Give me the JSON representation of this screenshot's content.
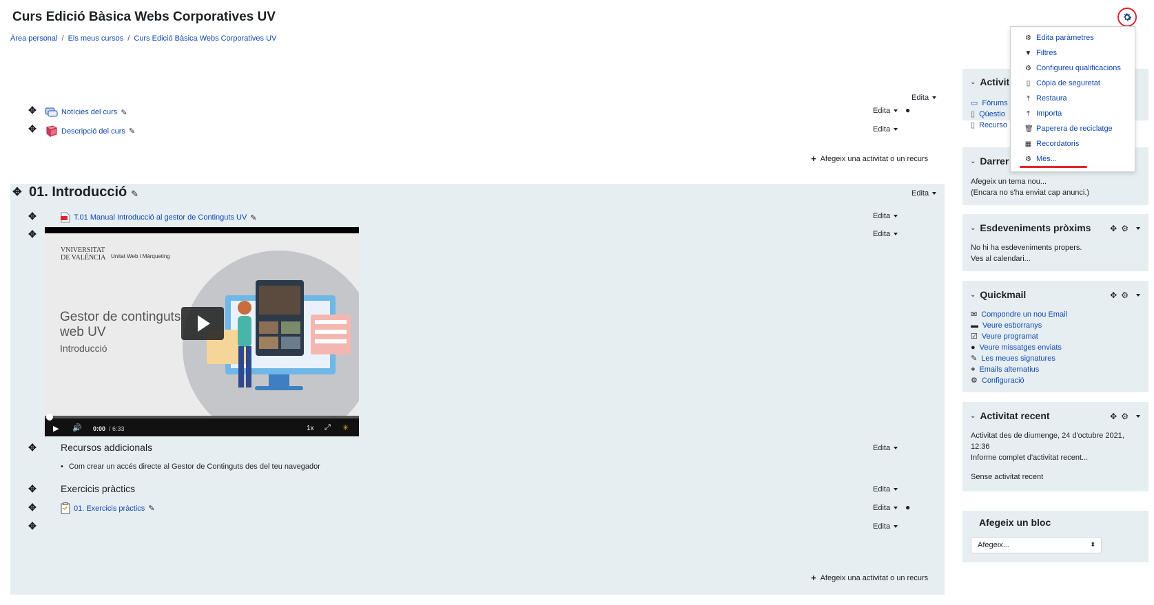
{
  "course": {
    "title": "Curs Edició Bàsica Webs Corporatives UV",
    "breadcrumb": [
      "Àrea personal",
      "Els meus cursos",
      "Curs Edició Bàsica Webs Corporatives UV"
    ]
  },
  "top": {
    "edita": "Edita",
    "mods": [
      {
        "label": "Notícies del curs",
        "edita": "Edita"
      },
      {
        "label": "Descripció del curs",
        "edita": "Edita"
      }
    ],
    "add_activity": "Afegeix una activitat o un recurs"
  },
  "section": {
    "title": "01. Introducció",
    "edita": "Edita",
    "mod1": {
      "label": "T.01 Manual Introducció al gestor de Continguts UV",
      "edita": "Edita"
    },
    "video_edita": "Edita",
    "video": {
      "logo_line1": "VNIVERSITAT",
      "logo_line2": "DE VALÈNCIA",
      "unit": "Unitat Web i Màrqueting",
      "title_line1": "Gestor de continguts",
      "title_line2": "web UV",
      "subtitle": "Introducció",
      "time_current": "0:00",
      "time_total": "/ 6:33",
      "speed": "1x",
      "progress": 0
    },
    "recursos": {
      "title": "Recursos addicionals",
      "edita": "Edita",
      "item": "Com crear un accés directe al Gestor de Continguts des del teu navegador"
    },
    "exercicis": {
      "title": "Exercicis pràctics",
      "edita": "Edita"
    },
    "mod2": {
      "label": "01. Exercicis pràctics",
      "edita": "Edita"
    },
    "empty_edita": "Edita",
    "add_activity": "Afegeix una activitat o un recurs"
  },
  "dropdown": {
    "items": [
      {
        "icon": "gear-icon",
        "label": "Edita paràmetres"
      },
      {
        "icon": "filter-icon",
        "label": "Filtres"
      },
      {
        "icon": "gear-icon",
        "label": "Configureu qualificacions"
      },
      {
        "icon": "file-icon",
        "label": "Còpia de seguretat"
      },
      {
        "icon": "upload-icon",
        "label": "Restaura"
      },
      {
        "icon": "upload-icon",
        "label": "Importa"
      },
      {
        "icon": "trash-icon",
        "label": "Paperera de reciclatge"
      },
      {
        "icon": "calendar-icon",
        "label": "Recordatoris"
      },
      {
        "icon": "gear-icon",
        "label": "Més..."
      }
    ]
  },
  "blocks": {
    "activitats": {
      "title": "Activit",
      "items": [
        "Fòrums",
        "Qüestio",
        "Recurso"
      ]
    },
    "darreres": {
      "title": "Darrer",
      "line1": "Afegeix un tema nou...",
      "line2": "(Encara no s'ha enviat cap anunci.)"
    },
    "esdeveniments": {
      "title": "Esdeveniments pròxims",
      "line1": "No hi ha esdeveniments propers.",
      "line2": "Ves al calendari..."
    },
    "quickmail": {
      "title": "Quickmail",
      "items": [
        "Compondre un nou Email",
        "Veure esborranys",
        "Veure programat",
        "Veure missatges enviats",
        "Les meues signatures",
        "Emails alternatius",
        "Configuració"
      ]
    },
    "recent": {
      "title": "Activitat recent",
      "line1": "Activitat des de diumenge, 24 d'octubre 2021,",
      "line2": "12:36",
      "link": "Informe complet d'activitat recent...",
      "none": "Sense activitat recent"
    },
    "afegeix": {
      "title": "Afegeix un bloc",
      "select_value": "Afegeix..."
    }
  },
  "colors": {
    "accent": "#0f47ad",
    "block_bg": "#e6eef2",
    "highlight": "#e0262c"
  }
}
